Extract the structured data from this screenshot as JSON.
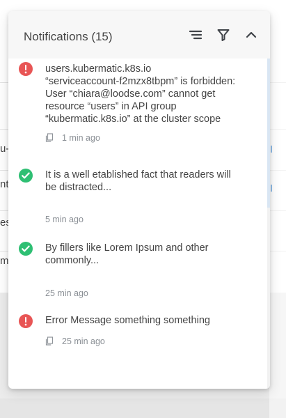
{
  "background": {
    "fragments": [
      "u-g",
      "nt",
      "es",
      "m"
    ]
  },
  "panel": {
    "title": "Notifications (15)",
    "icons": {
      "sort": "sort-icon",
      "filter": "filter-icon",
      "collapse": "chevron-up-icon"
    }
  },
  "notifications": [
    {
      "status": "error",
      "message": "users.kubermatic.k8s.io\n“serviceaccount-f2mzx8tbpm” is forbidden:\nUser “chiara@loodse.com” cannot get\nresource “users” in API group\n“kubermatic.k8s.io” at the cluster scope",
      "time": "1 min ago",
      "has_copy": true
    },
    {
      "status": "success",
      "message": "It is a well etablished fact that readers will\nbe distracted...",
      "time": "5 min ago",
      "has_copy": false
    },
    {
      "status": "success",
      "message": "By fillers like Lorem Ipsum and other\ncommonly...",
      "time": "25 min ago",
      "has_copy": false
    },
    {
      "status": "error",
      "message": "Error Message something something",
      "time": "25 min ago",
      "has_copy": true
    }
  ],
  "colors": {
    "error": "#e85555",
    "success": "#2ebf73",
    "accent": "#90bde8"
  }
}
